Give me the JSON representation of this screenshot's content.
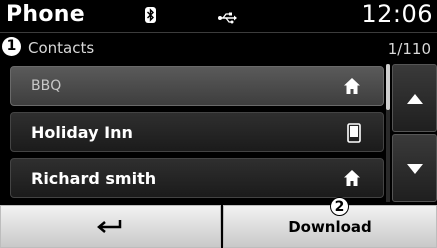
{
  "status_bar": {
    "title": "Phone",
    "bluetooth_icon": "bluetooth-icon",
    "usb_icon": "usb-icon",
    "clock": "12:06"
  },
  "subheader": {
    "callout": "1",
    "label": "Contacts",
    "page_counter": "1/110"
  },
  "contacts": [
    {
      "name": "BBQ",
      "icon": "home-icon",
      "selected": true
    },
    {
      "name": "Holiday Inn",
      "icon": "mobile-phone-icon",
      "selected": false
    },
    {
      "name": "Richard smith",
      "icon": "home-icon",
      "selected": false
    }
  ],
  "scroll": {
    "up_icon": "arrow-up-icon",
    "down_icon": "arrow-down-icon"
  },
  "bottom_bar": {
    "back_icon": "back-arrow-icon",
    "download_label": "Download",
    "download_callout": "2"
  }
}
